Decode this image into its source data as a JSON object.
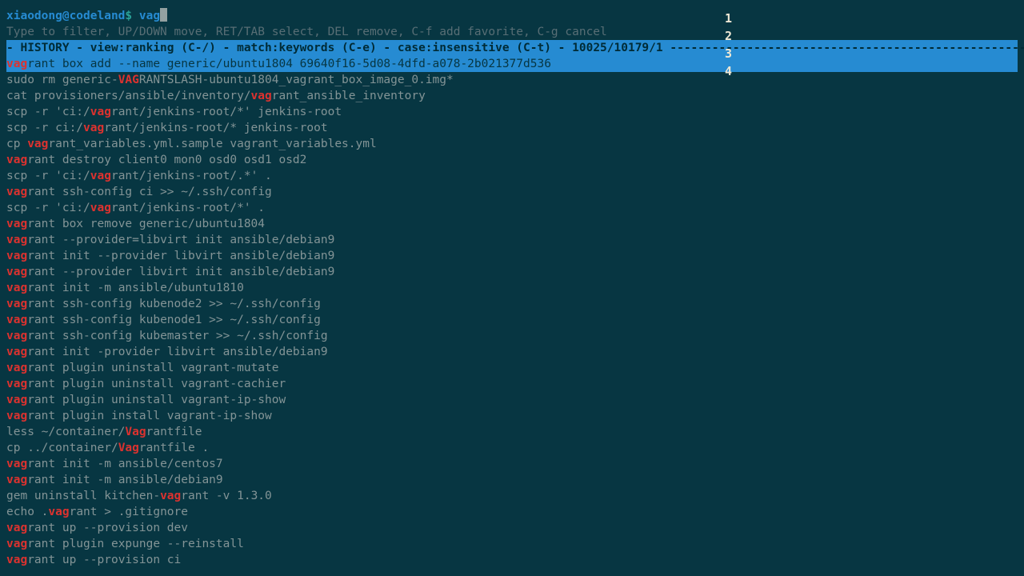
{
  "prompt": {
    "user_host": "xiaodong@codeland",
    "symbol": "$",
    "input": "vag"
  },
  "hint": "Type to filter, UP/DOWN move, RET/TAB select, DEL remove, C-f add favorite, C-g cancel",
  "header": {
    "prefix": "- HISTORY - view:",
    "view": "ranking",
    "view_key": " (C-/) ",
    "match_prefix": "- match:",
    "match": "keywords",
    "match_key": " (C-e) ",
    "case_prefix": "- case:",
    "case": "insensitive",
    "case_key": " (C-t) ",
    "stats": "- 10025/10179/1 ",
    "dashes": "-----------------------------------------------------"
  },
  "history": [
    {
      "pre": "",
      "m": "vag",
      "post": "rant box add --name generic/ubuntu1804 69640f16-5d08-4dfd-a078-2b021377d536",
      "selected": true
    },
    {
      "pre": "sudo rm generic-",
      "m": "VAG",
      "post": "RANTSLASH-ubuntu1804_vagrant_box_image_0.img*"
    },
    {
      "pre": "cat provisioners/ansible/inventory/",
      "m": "vag",
      "post": "rant_ansible_inventory"
    },
    {
      "pre": "scp -r 'ci:/",
      "m": "vag",
      "post": "rant/jenkins-root/*' jenkins-root"
    },
    {
      "pre": "scp -r ci:/",
      "m": "vag",
      "post": "rant/jenkins-root/* jenkins-root"
    },
    {
      "pre": "cp ",
      "m": "vag",
      "post": "rant_variables.yml.sample vagrant_variables.yml"
    },
    {
      "pre": "",
      "m": "vag",
      "post": "rant destroy client0 mon0 osd0 osd1 osd2"
    },
    {
      "pre": "scp -r 'ci:/",
      "m": "vag",
      "post": "rant/jenkins-root/.*' ."
    },
    {
      "pre": "",
      "m": "vag",
      "post": "rant ssh-config ci >> ~/.ssh/config"
    },
    {
      "pre": "scp -r 'ci:/",
      "m": "vag",
      "post": "rant/jenkins-root/*' ."
    },
    {
      "pre": "",
      "m": "vag",
      "post": "rant box remove generic/ubuntu1804"
    },
    {
      "pre": "",
      "m": "vag",
      "post": "rant --provider=libvirt init ansible/debian9"
    },
    {
      "pre": "",
      "m": "vag",
      "post": "rant init --provider libvirt ansible/debian9"
    },
    {
      "pre": "",
      "m": "vag",
      "post": "rant --provider libvirt init ansible/debian9"
    },
    {
      "pre": "",
      "m": "vag",
      "post": "rant init -m ansible/ubuntu1810"
    },
    {
      "pre": "",
      "m": "vag",
      "post": "rant ssh-config kubenode2 >> ~/.ssh/config"
    },
    {
      "pre": "",
      "m": "vag",
      "post": "rant ssh-config kubenode1 >> ~/.ssh/config"
    },
    {
      "pre": "",
      "m": "vag",
      "post": "rant ssh-config kubemaster >> ~/.ssh/config"
    },
    {
      "pre": "",
      "m": "vag",
      "post": "rant init -provider libvirt ansible/debian9"
    },
    {
      "pre": "",
      "m": "vag",
      "post": "rant plugin uninstall vagrant-mutate"
    },
    {
      "pre": "",
      "m": "vag",
      "post": "rant plugin uninstall vagrant-cachier"
    },
    {
      "pre": "",
      "m": "vag",
      "post": "rant plugin uninstall vagrant-ip-show"
    },
    {
      "pre": "",
      "m": "vag",
      "post": "rant plugin install vagrant-ip-show"
    },
    {
      "pre": "less ~/container/",
      "m": "Vag",
      "post": "rantfile"
    },
    {
      "pre": "cp ../container/",
      "m": "Vag",
      "post": "rantfile ."
    },
    {
      "pre": "",
      "m": "vag",
      "post": "rant init -m ansible/centos7"
    },
    {
      "pre": "",
      "m": "vag",
      "post": "rant init -m ansible/debian9"
    },
    {
      "pre": "gem uninstall kitchen-",
      "m": "vag",
      "post": "rant -v 1.3.0"
    },
    {
      "pre": "echo .",
      "m": "vag",
      "post": "rant > .gitignore"
    },
    {
      "pre": "",
      "m": "vag",
      "post": "rant up --provision dev"
    },
    {
      "pre": "",
      "m": "vag",
      "post": "rant plugin expunge --reinstall"
    },
    {
      "pre": "",
      "m": "vag",
      "post": "rant up --provision ci"
    }
  ],
  "side_numbers": [
    "1",
    "2",
    "3",
    "4"
  ]
}
